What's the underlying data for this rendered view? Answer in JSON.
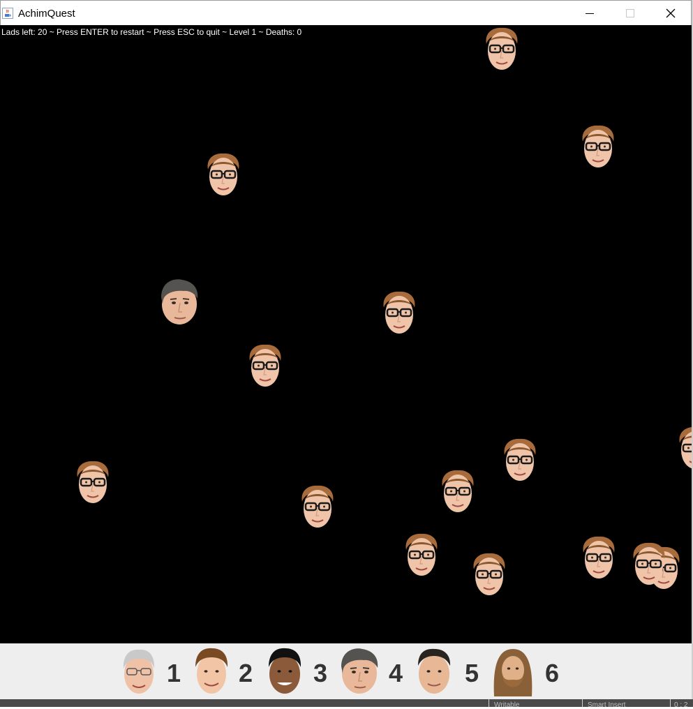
{
  "window": {
    "title": "AchimQuest",
    "app_icon": "java-cup-icon"
  },
  "controls": {
    "minimize": "minimize-icon",
    "maximize": "maximize-icon",
    "close": "close-icon"
  },
  "status": {
    "text": "Lads left: 20 ~ Press ENTER to restart ~ Press ESC to quit ~ Level 1 ~ Deaths: 0"
  },
  "game": {
    "background": "#000000",
    "player": {
      "type": "grey-haired-man-face"
    },
    "lads": {
      "type": "glasses-lad-face"
    }
  },
  "toolbar": {
    "characters": [
      {
        "number": "1",
        "face": "white-haired-glasses-face"
      },
      {
        "number": "2",
        "face": "brown-haired-smiling-face"
      },
      {
        "number": "3",
        "face": "dark-haired-smiling-face"
      },
      {
        "number": "4",
        "face": "grey-haired-man-face"
      },
      {
        "number": "5",
        "face": "short-dark-haired-face"
      },
      {
        "number": "6",
        "face": "long-haired-bearded-face"
      }
    ]
  },
  "taskbar": {
    "item1": "Writable",
    "item2": "Smart Insert",
    "item3": "0 : 2"
  }
}
